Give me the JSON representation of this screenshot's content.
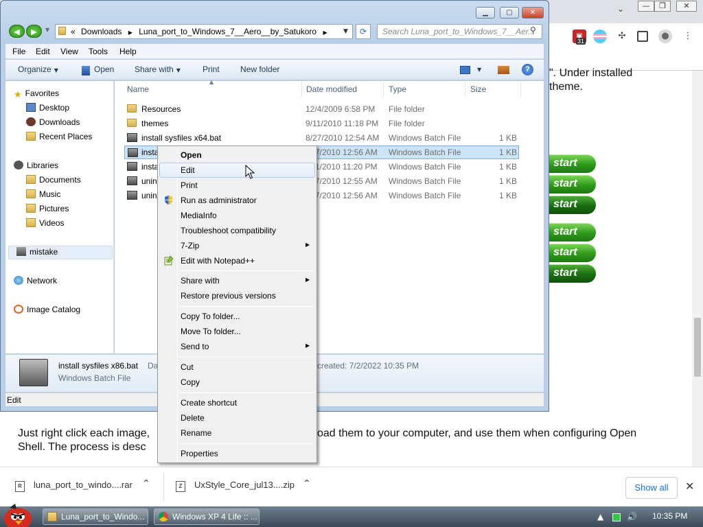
{
  "browser": {
    "window_controls": [
      "—",
      "❐",
      "✕"
    ],
    "chevron": "⌄",
    "extension_badge": "31",
    "page_text_top_1": "\".  Under installed",
    "page_text_top_2": "theme.",
    "start_button_label": "start",
    "page_text_bottom_1": "Just right click each image,",
    "page_text_bottom_1b": "oad them to your computer, and use them when configuring Open",
    "page_text_bottom_2": "Shell.  The process is desc",
    "download_bar": {
      "items": [
        {
          "name": "luna_port_to_windo....rar"
        },
        {
          "name": "UxStyle_Core_jul13....zip"
        }
      ],
      "show_all": "Show all"
    }
  },
  "taskbar": {
    "buttons": [
      {
        "label": "Luna_port_to_Windo..."
      },
      {
        "label": "Windows XP 4 Life :: ..."
      }
    ],
    "clock": "10:35 PM"
  },
  "explorer": {
    "breadcrumb": [
      "«",
      "Downloads",
      "Luna_port_to_Windows_7__Aero__by_Satukoro"
    ],
    "search_placeholder": "Search Luna_port_to_Windows_7__Aer...",
    "menu": [
      "File",
      "Edit",
      "View",
      "Tools",
      "Help"
    ],
    "commands": {
      "organize": "Organize",
      "open": "Open",
      "share_with": "Share with",
      "print": "Print",
      "new_folder": "New folder"
    },
    "nav": {
      "favorites": "Favorites",
      "desktop": "Desktop",
      "downloads": "Downloads",
      "recent": "Recent Places",
      "libraries": "Libraries",
      "documents": "Documents",
      "music": "Music",
      "pictures": "Pictures",
      "videos": "Videos",
      "mistake": "mistake",
      "network": "Network",
      "image_catalog": "Image Catalog"
    },
    "columns": [
      "Name",
      "Date modified",
      "Type",
      "Size"
    ],
    "files": [
      {
        "name": "Resources",
        "date": "12/4/2009 6:58 PM",
        "type": "File folder",
        "size": ""
      },
      {
        "name": "themes",
        "date": "9/11/2010 11:18 PM",
        "type": "File folder",
        "size": ""
      },
      {
        "name": "install sysfiles x64.bat",
        "date": "8/27/2010 12:54 AM",
        "type": "Windows Batch File",
        "size": "1 KB"
      },
      {
        "name": "insta",
        "date": "7/2010 12:56 AM",
        "type": "Windows Batch File",
        "size": "1 KB"
      },
      {
        "name": "insta",
        "date": "1/2010 11:20 PM",
        "type": "Windows Batch File",
        "size": "1 KB"
      },
      {
        "name": "unin",
        "date": "7/2010 12:55 AM",
        "type": "Windows Batch File",
        "size": "1 KB"
      },
      {
        "name": "unin",
        "date": "7/2010 12:56 AM",
        "type": "Windows Batch File",
        "size": "1 KB"
      }
    ],
    "details": {
      "filename": "install sysfiles x86.bat",
      "type": "Windows Batch File",
      "date_label_cut": "Da",
      "created": "created:  7/2/2022 10:35 PM"
    },
    "status": "Edit"
  },
  "context_menu": {
    "items": [
      {
        "label": "Open",
        "bold": true
      },
      {
        "label": "Edit"
      },
      {
        "label": "Print"
      },
      {
        "label": "Run as administrator",
        "icon": "shield-icon"
      },
      {
        "label": "MediaInfo"
      },
      {
        "label": "Troubleshoot compatibility"
      },
      {
        "label": "7-Zip",
        "submenu": true
      },
      {
        "label": "Edit with Notepad++",
        "icon": "notepad-icon"
      },
      {
        "label": "Share with",
        "submenu": true
      },
      {
        "label": "Restore previous versions"
      },
      {
        "label": "Copy To folder..."
      },
      {
        "label": "Move To folder..."
      },
      {
        "label": "Send to",
        "submenu": true
      },
      {
        "label": "Cut"
      },
      {
        "label": "Copy"
      },
      {
        "label": "Create shortcut"
      },
      {
        "label": "Delete"
      },
      {
        "label": "Rename"
      },
      {
        "label": "Properties"
      }
    ]
  }
}
